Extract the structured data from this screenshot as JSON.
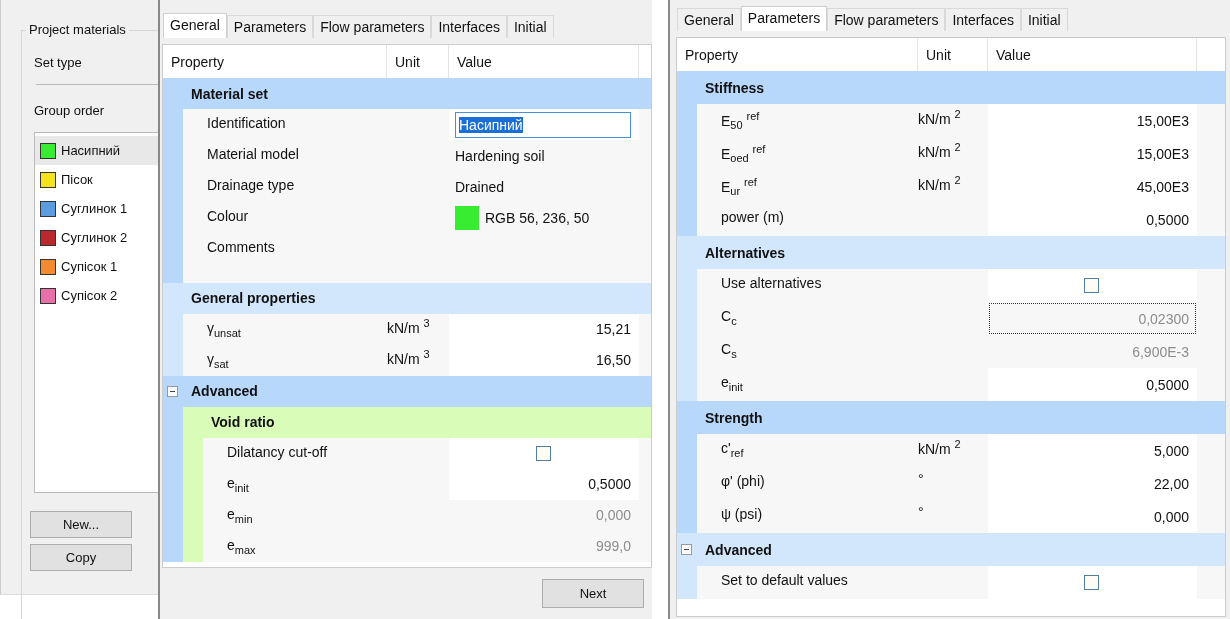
{
  "left_panel": {
    "group_title": "Project materials",
    "set_type_label": "Set type",
    "group_order_label": "Group order",
    "materials": [
      {
        "name": "Насипний",
        "color": "#38ec32",
        "selected": true
      },
      {
        "name": "Пісок",
        "color": "#f3e41c",
        "selected": false
      },
      {
        "name": "Суглинок 1",
        "color": "#5b9be0",
        "selected": false
      },
      {
        "name": "Суглинок 2",
        "color": "#b8282c",
        "selected": false
      },
      {
        "name": "Супісок 1",
        "color": "#f28a30",
        "selected": false
      },
      {
        "name": "Супісок 2",
        "color": "#e870a8",
        "selected": false
      }
    ],
    "buttons": [
      "New...",
      "Copy"
    ]
  },
  "general_panel": {
    "tabs": [
      {
        "label": "General",
        "selected": true
      },
      {
        "label": "Parameters",
        "selected": false
      },
      {
        "label": "Flow parameters",
        "selected": false
      },
      {
        "label": "Interfaces",
        "selected": false
      },
      {
        "label": "Initial",
        "selected": false
      }
    ],
    "columns": [
      "Property",
      "Unit",
      "Value"
    ],
    "sections": [
      {
        "kind": "section",
        "title": "Material set",
        "color": "#b7d7fb",
        "children": [
          {
            "kind": "input",
            "property": "Identification",
            "value": "Насипний"
          },
          {
            "kind": "text",
            "property": "Material model",
            "value": "Hardening soil"
          },
          {
            "kind": "text",
            "property": "Drainage type",
            "value": "Drained"
          },
          {
            "kind": "swatch",
            "property": "Colour",
            "value": "RGB 56, 236, 50",
            "color": "#38ec32"
          },
          {
            "kind": "multiline",
            "property": "Comments"
          }
        ]
      },
      {
        "kind": "section",
        "title": "General properties",
        "color": "#d2e6fc",
        "children": [
          {
            "kind": "number",
            "property": "γ$_{unsat}$",
            "unit": "kN/m $^{3}$",
            "value": "15,21",
            "disabled": false
          },
          {
            "kind": "number",
            "property": "γ$_{sat}$",
            "unit": "kN/m $^{3}$",
            "value": "16,50",
            "disabled": false
          }
        ]
      },
      {
        "kind": "section",
        "title": "Advanced",
        "color": "#b7d7fb",
        "expanded": true,
        "children": [
          {
            "kind": "section",
            "title": "Void ratio",
            "color": "#d9fdb9",
            "children": [
              {
                "kind": "checkbox",
                "property": "Dilatancy cut-off",
                "checked": false
              },
              {
                "kind": "number",
                "property": "e$_{init}$",
                "value": "0,5000",
                "disabled": false
              },
              {
                "kind": "number",
                "property": "e$_{min}$",
                "value": "0,000",
                "disabled": true
              },
              {
                "kind": "number",
                "property": "e$_{max}$",
                "value": "999,0",
                "disabled": true
              }
            ]
          }
        ]
      }
    ],
    "next_button": "Next"
  },
  "parameters_panel": {
    "tabs": [
      {
        "label": "General",
        "selected": false
      },
      {
        "label": "Parameters",
        "selected": true
      },
      {
        "label": "Flow parameters",
        "selected": false
      },
      {
        "label": "Interfaces",
        "selected": false
      },
      {
        "label": "Initial",
        "selected": false
      }
    ],
    "columns": [
      "Property",
      "Unit",
      "Value"
    ],
    "sections": [
      {
        "kind": "section",
        "title": "Stiffness",
        "color": "#b7d7fb",
        "children": [
          {
            "kind": "number",
            "property": "E$_{50}$ $^{ref}$",
            "unit": "kN/m $^{2}$",
            "value": "15,00E3",
            "disabled": false
          },
          {
            "kind": "number",
            "property": "E$_{oed}$ $^{ref}$",
            "unit": "kN/m $^{2}$",
            "value": "15,00E3",
            "disabled": false
          },
          {
            "kind": "number",
            "property": "E$_{ur}$ $^{ref}$",
            "unit": "kN/m $^{2}$",
            "value": "45,00E3",
            "disabled": false
          },
          {
            "kind": "number",
            "property": "power (m)",
            "value": "0,5000",
            "disabled": false
          }
        ]
      },
      {
        "kind": "section",
        "title": "Alternatives",
        "color": "#d2e6fc",
        "children": [
          {
            "kind": "checkbox",
            "property": "Use alternatives",
            "checked": false
          },
          {
            "kind": "number",
            "property": "C$_{c}$",
            "value": "0,02300",
            "disabled": true,
            "focused": true
          },
          {
            "kind": "number",
            "property": "C$_{s}$",
            "value": "6,900E-3",
            "disabled": true
          },
          {
            "kind": "number",
            "property": "e$_{init}$",
            "value": "0,5000",
            "disabled": false
          }
        ]
      },
      {
        "kind": "section",
        "title": "Strength",
        "color": "#b7d7fb",
        "children": [
          {
            "kind": "number",
            "property": "c'$_{ref}$",
            "unit": "kN/m $^{2}$",
            "value": "5,000",
            "disabled": false
          },
          {
            "kind": "number",
            "property": "φ' (phi)",
            "unit": "°",
            "value": "22,00",
            "disabled": false
          },
          {
            "kind": "number",
            "property": "ψ (psi)",
            "unit": "°",
            "value": "0,000",
            "disabled": false
          }
        ]
      },
      {
        "kind": "section",
        "title": "Advanced",
        "color": "#d2e6fc",
        "expanded": true,
        "children": [
          {
            "kind": "checkbox",
            "property": "Set to default values",
            "checked": false
          }
        ]
      }
    ]
  }
}
